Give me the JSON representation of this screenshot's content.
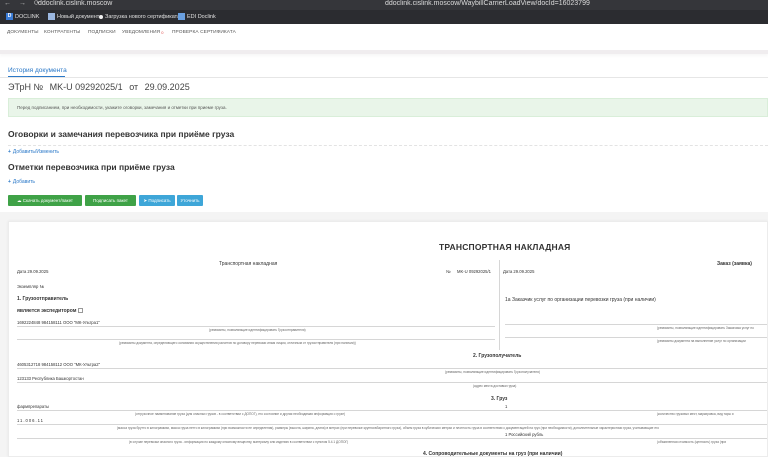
{
  "browser": {
    "nav_glyphs": "← → ⟳",
    "host": "ddoclink.cislink.moscow",
    "url": "ddoclink.cislink.moscow/WaybillCarrierLoadView/docId=16023799"
  },
  "bookmarks": {
    "logo": "D",
    "app": "DOCLINK",
    "new_doc": "Новый документ",
    "cert": "Загрузка нового сертификата",
    "edi": "EDI Doclink"
  },
  "nav": {
    "items": [
      "ДОКУМЕНТЫ",
      "КОНТРАГЕНТЫ",
      "ПОДПИСКИ",
      "УВЕДОМЛЕНИЯ",
      "ПРОВЕРКА СЕРТИФИКАТА"
    ],
    "notifications_badge": "0"
  },
  "main": {
    "history_link": "История документа",
    "doc_type": "ЭТрН №",
    "doc_number": "MK-U 09292025/1",
    "doc_date_prefix": "от",
    "doc_date": "29.09.2025",
    "banner": "Перед подписанием, при необходимости, укажите оговорки, замечания и отметки при приеме груза.",
    "remarks_title": "Оговорки и замечания перевозчика при приёме груза",
    "remarks_add": "Добавить/Изменить",
    "marks_title": "Отметки перевозчика при приёме груза",
    "marks_add": "Добавить",
    "buttons": {
      "download": "Скачать документ/пакет",
      "sign_package": "Подписать пакет",
      "sign": "Подписать",
      "clarify": "Уточнить"
    }
  },
  "preview": {
    "title": "ТРАНСПОРТНАЯ НАКЛАДНАЯ",
    "left_title": "Транспортная накладная",
    "right_title": "Заказ (заявка)",
    "date_left": "Дата 29.09.2025",
    "number_label": "№",
    "number_value": "MK-U 09292025/1",
    "date_right": "Дата 29.09.2025",
    "copy_label": "Экземпляр №",
    "s1_title": "1. Грузоотправитель",
    "forwarder": "является экспедитором",
    "shipper_text": "1692224848 984158111 ООО \"МК-Ультра1\"",
    "shipper_caption": "(реквизиты, позволяющие идентифицировать Грузоотправителя)",
    "shipper_caption2": "(реквизиты документа, определяющего основания осуществления расчетов по договору перевозки иным лицом, отличным от грузоотправителя (при наличии))",
    "order_text": "1а Заказчик услуг по организации перевозки груза (при наличии)",
    "order_caption": "(реквизиты, позволяющие идентифицировать Заказчика услуг по",
    "order_caption2": "(реквизиты документа на выполнение услуг по организации",
    "s2_title": "2. Грузополучатель",
    "consignee_text": "4605312718 984158112 ООО \"МК-Ультра2\"",
    "consignee_caption": "(реквизиты, позволяющие идентифицировать Грузополучателя)",
    "address_text": "123133 Республика Башкортостан",
    "address_caption": "(адрес места доставки груза)",
    "s3_title": "3. Груз",
    "cargo_left": "фармпрепараты",
    "cargo_caption": "(отгрузочное наименование груза (для опасных грузов - в соответствии с ДОПОГ), его состояние и другая необходимая информация о грузе)",
    "cargo_qty": "1",
    "cargo_qty_caption": "(количество грузовых мест, маркировка, вид тары и",
    "cargo_code": "11.006.11",
    "cargo_code_caption": "(масса груза брутто в килограммах, масса груза нетто в килограммах (при возможности ее определения), размеры (высота, ширина, длина) в метрах (при перевозке крупногабаритного груза), объем груза в кубических метрах и плотность груза в соответствии с документацией на груз (при необходимости), дополнительные характеристики груза, учитывающие его",
    "cargo_price": "1 Российский рубль",
    "cargo_price_caption": "(объявленная стоимость (ценность) груза (при",
    "cargo_hazard_caption": "(в случае перевозки опасного груза - информация по каждому опасному веществу, материалу или изделию в соответствии с пунктом 5.4.1 ДОПОГ)",
    "s4_title": "4. Сопроводительные документы на груз (при наличии)"
  }
}
